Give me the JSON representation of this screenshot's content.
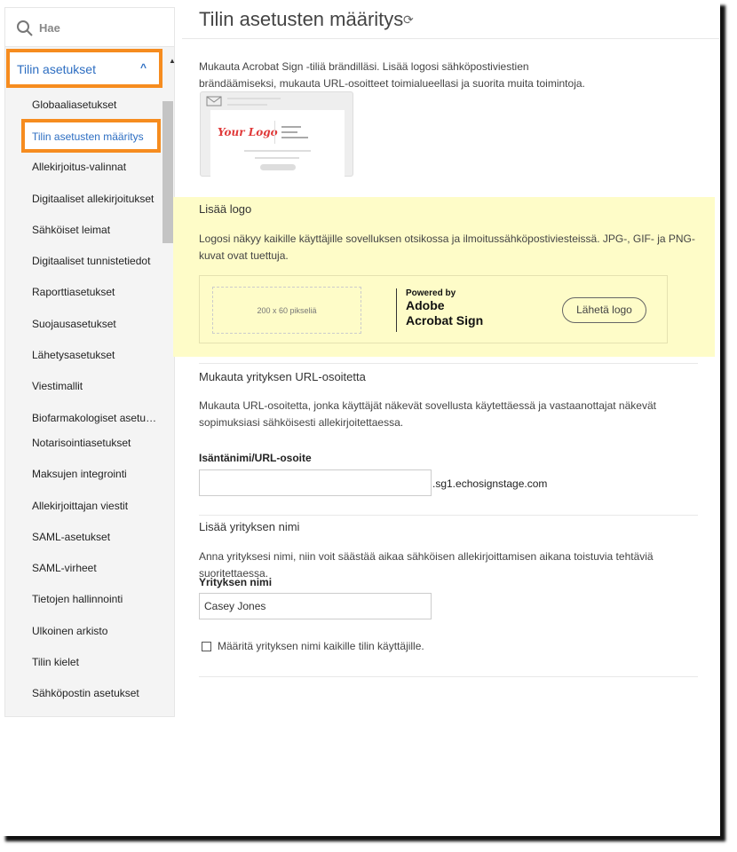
{
  "sidebar": {
    "search_placeholder": "Hae",
    "section": "Tilin asetukset",
    "items": [
      "Globaaliasetukset",
      "Tilin asetusten määritys",
      "Allekirjoitus-valinnat",
      "Digitaaliset allekirjoitukset",
      "Sähköiset leimat",
      "Digitaaliset tunnistetiedot",
      "Raporttiasetukset",
      "Suojausasetukset",
      "Lähetysasetukset",
      "Viestimallit",
      "Biofarmakologiset asetu…",
      "Notarisointiasetukset",
      "Maksujen integrointi",
      "Allekirjoittajan viestit",
      "SAML-asetukset",
      "SAML-virheet",
      "Tietojen hallinnointi",
      "Ulkoinen arkisto",
      "Tilin kielet",
      "Sähköpostin asetukset"
    ],
    "selected_index": 1
  },
  "main": {
    "title": "Tilin asetusten määritys",
    "intro": "Mukauta Acrobat Sign -tiliä brändilläsi. Lisää logosi sähköpostiviestien brändäämiseksi, mukauta URL-osoitteet toimialueellasi ja suorita muita toimintoja.",
    "preview_logo": "Your Logo",
    "logo": {
      "heading": "Lisää logo",
      "description": "Logosi näkyy kaikille käyttäjille sovelluksen otsikossa ja ilmoitussähköpostiviesteissä. JPG-, GIF- ja PNG-kuvat ovat tuettuja.",
      "placeholder": "200 x 60 pikseliä",
      "powered_by": "Powered by",
      "brand_line1": "Adobe",
      "brand_line2": "Acrobat Sign",
      "upload_button": "Lähetä logo",
      "highlight_color": "#fefcc8"
    },
    "url": {
      "heading": "Mukauta yrityksen URL-osoitetta",
      "description": "Mukauta URL-osoitetta, jonka käyttäjät näkevät sovellusta käytettäessä ja vastaanottajat näkevät sopimuksiasi sähköisesti allekirjoitettaessa.",
      "label": "Isäntänimi/URL-osoite",
      "value": "",
      "suffix": ".sg1.echosignstage.com"
    },
    "company": {
      "heading": "Lisää yrityksen nimi",
      "description": "Anna yrityksesi nimi, niin voit säästää aikaa sähköisen allekirjoittamisen aikana toistuvia tehtäviä suoritettaessa.",
      "label": "Yrityksen nimi",
      "value": "Casey Jones",
      "checkbox_label": "Määritä yrityksen nimi kaikille tilin käyttäjille.",
      "checkbox_checked": false
    }
  },
  "colors": {
    "accent": "#2d6ec2",
    "annotation": "#f68c1f"
  }
}
